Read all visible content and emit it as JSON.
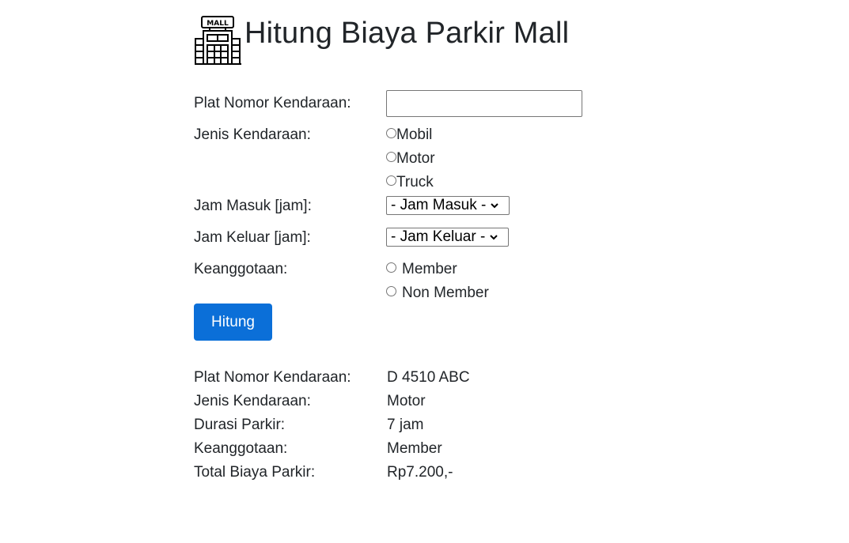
{
  "page": {
    "title": "Hitung Biaya Parkir Mall",
    "logo_icon": "mall-building-icon"
  },
  "form": {
    "plate_label": "Plat Nomor Kendaraan:",
    "plate_value": "",
    "plate_placeholder": "",
    "vehicle_type_label": "Jenis Kendaraan:",
    "vehicle_types": [
      {
        "label": "Mobil",
        "checked": false
      },
      {
        "label": "Motor",
        "checked": false
      },
      {
        "label": "Truck",
        "checked": false
      }
    ],
    "entry_label": "Jam Masuk [jam]:",
    "entry_select": "- Jam Masuk -",
    "exit_label": "Jam Keluar [jam]:",
    "exit_select": "- Jam Keluar -",
    "membership_label": "Keanggotaan:",
    "membership_options": [
      {
        "label": "Member",
        "checked": false
      },
      {
        "label": "Non Member",
        "checked": false
      }
    ],
    "submit_label": "Hitung"
  },
  "result": {
    "rows": [
      {
        "label": "Plat Nomor Kendaraan:",
        "value": "D 4510 ABC"
      },
      {
        "label": "Jenis Kendaraan:",
        "value": "Motor"
      },
      {
        "label": "Durasi Parkir:",
        "value": "7 jam"
      },
      {
        "label": "Keanggotaan:",
        "value": "Member"
      },
      {
        "label": "Total Biaya Parkir:",
        "value": "Rp7.200,-"
      }
    ]
  },
  "colors": {
    "primary_button": "#0b6fd8",
    "text": "#212529"
  }
}
